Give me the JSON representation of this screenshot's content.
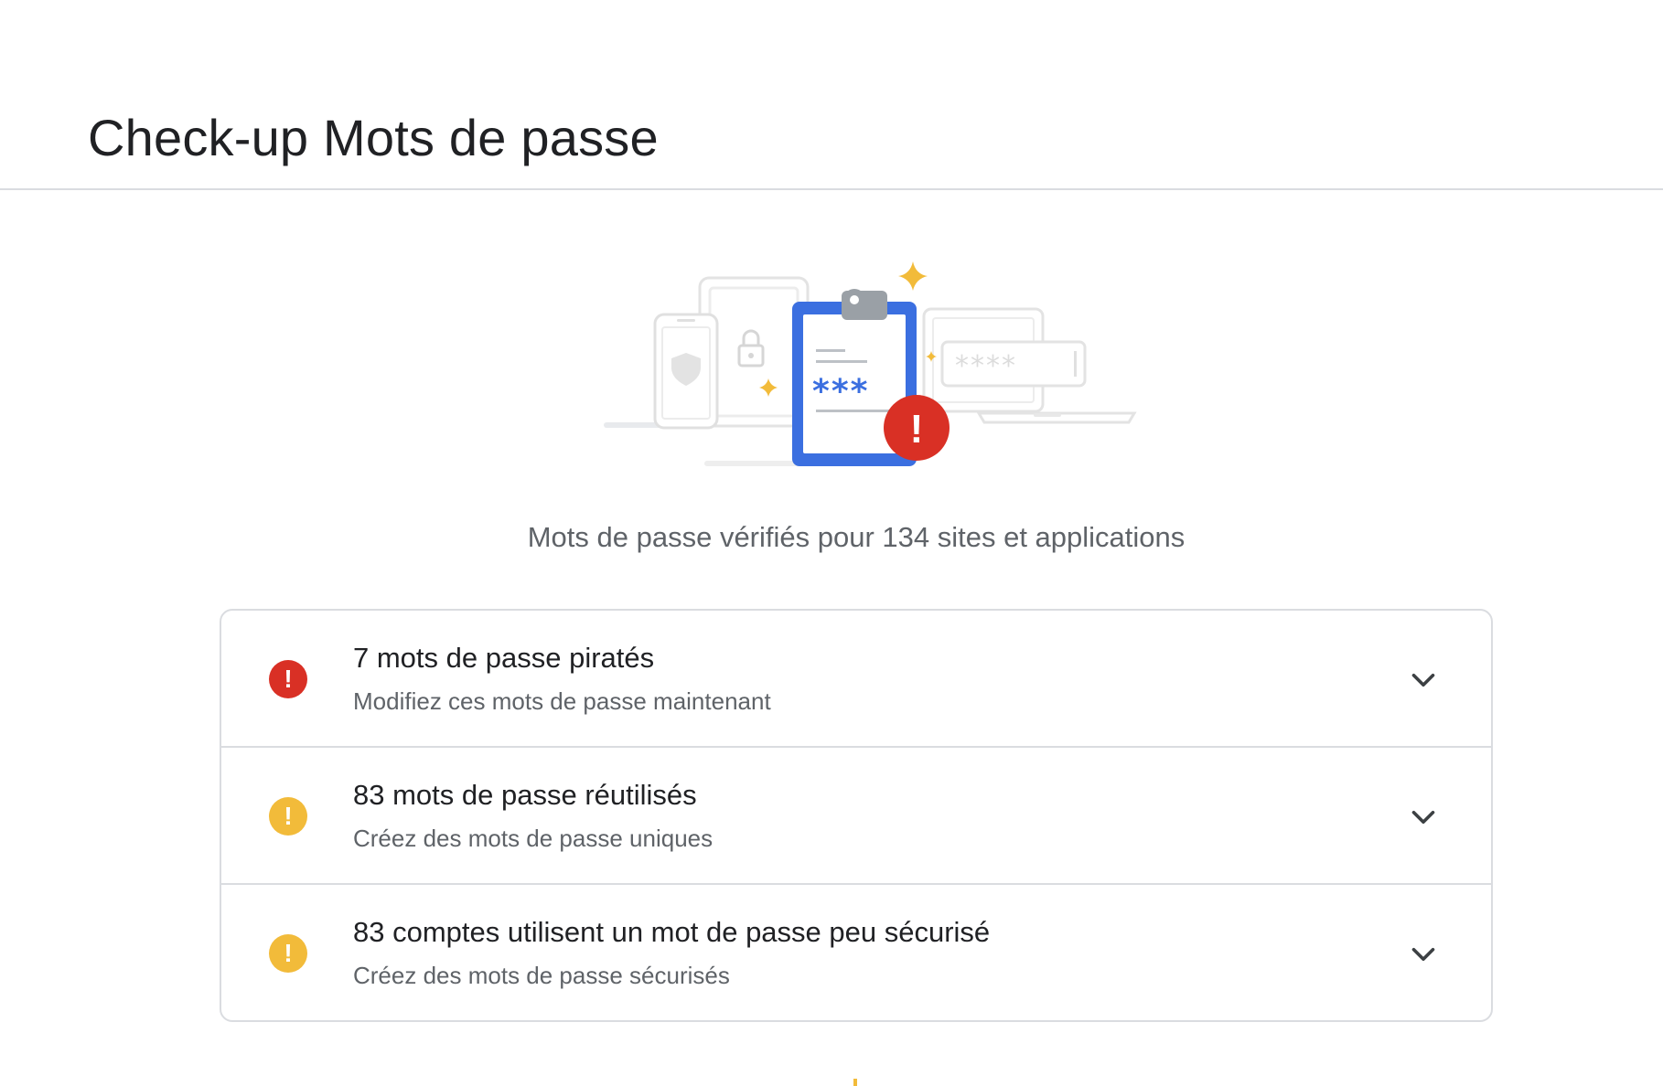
{
  "page": {
    "title": "Check-up Mots de passe"
  },
  "summary": {
    "text": "Mots de passe vérifiés pour 134 sites et applications"
  },
  "illustration": {
    "password_mask": "****",
    "clipboard_mask": "***",
    "alert_mark": "!"
  },
  "issues": [
    {
      "severity": "error",
      "icon": "error-icon",
      "color": "#d93025",
      "title": "7 mots de passe piratés",
      "subtitle": "Modifiez ces mots de passe maintenant"
    },
    {
      "severity": "warning",
      "icon": "warning-icon",
      "color": "#f2bb3a",
      "title": "83 mots de passe réutilisés",
      "subtitle": "Créez des mots de passe uniques"
    },
    {
      "severity": "warning",
      "icon": "warning-icon",
      "color": "#f2bb3a",
      "title": "83 comptes utilisent un mot de passe peu sécurisé",
      "subtitle": "Créez des mots de passe sécurisés"
    }
  ],
  "colors": {
    "error": "#d93025",
    "warning": "#f2bb3a",
    "accent_blue": "#3b6fe0",
    "divider": "#dadce0"
  }
}
